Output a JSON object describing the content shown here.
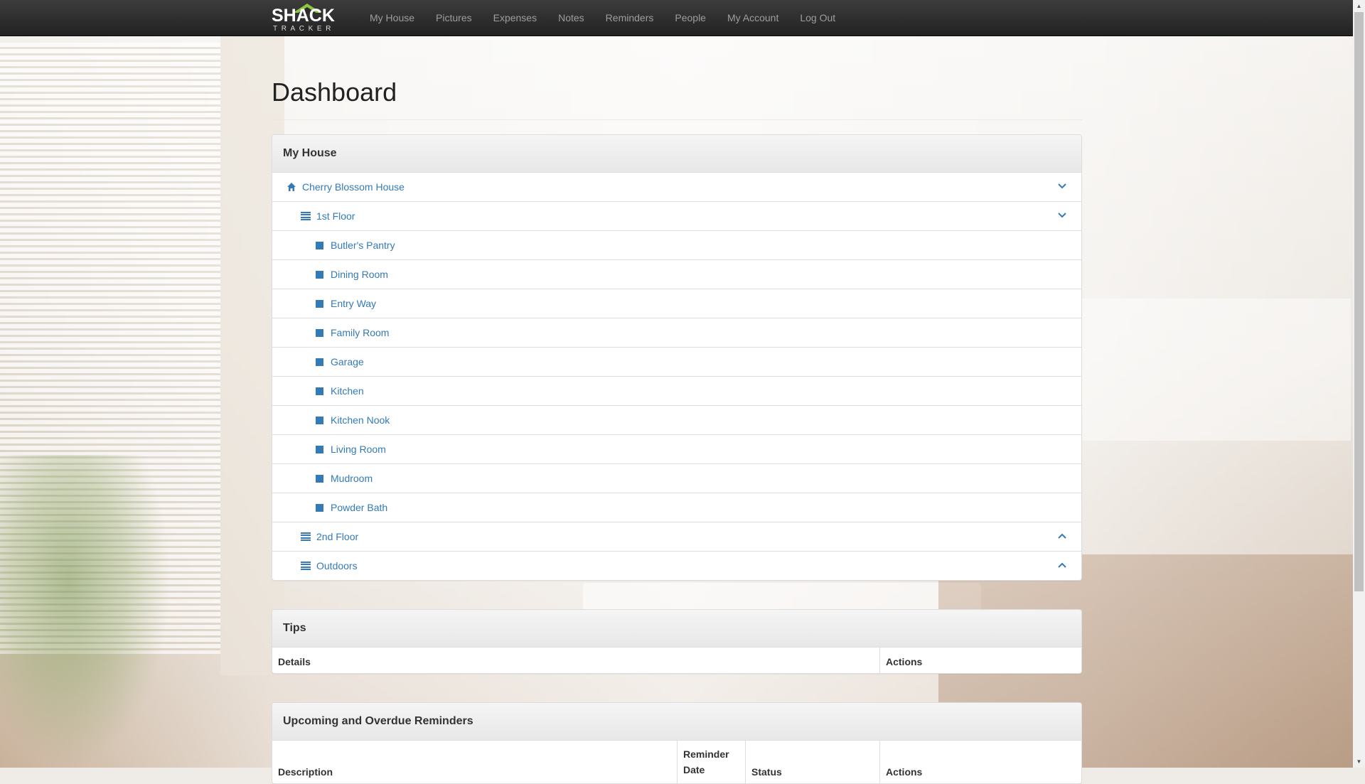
{
  "brand": {
    "logo_top": "SHACK",
    "logo_bottom": "TRACKER"
  },
  "nav": {
    "items": [
      {
        "label": "My House"
      },
      {
        "label": "Pictures"
      },
      {
        "label": "Expenses"
      },
      {
        "label": "Notes"
      },
      {
        "label": "Reminders"
      },
      {
        "label": "People"
      },
      {
        "label": "My Account"
      },
      {
        "label": "Log Out"
      }
    ]
  },
  "page": {
    "title": "Dashboard"
  },
  "my_house": {
    "heading": "My House",
    "house": "Cherry Blossom House",
    "floor1": "1st Floor",
    "rooms": [
      "Butler's Pantry",
      "Dining Room",
      "Entry Way",
      "Family Room",
      "Garage",
      "Kitchen",
      "Kitchen Nook",
      "Living Room",
      "Mudroom",
      "Powder Bath"
    ],
    "floor2": "2nd Floor",
    "outdoors": "Outdoors"
  },
  "tips": {
    "heading": "Tips",
    "columns": [
      "Details",
      "Actions"
    ]
  },
  "reminders": {
    "heading": "Upcoming and Overdue Reminders",
    "columns": [
      "Description",
      "Reminder Date",
      "Status",
      "Actions"
    ]
  },
  "colors": {
    "link": "#337ab7",
    "navbar": "#222222",
    "accent_logo": "#8dc63f"
  }
}
